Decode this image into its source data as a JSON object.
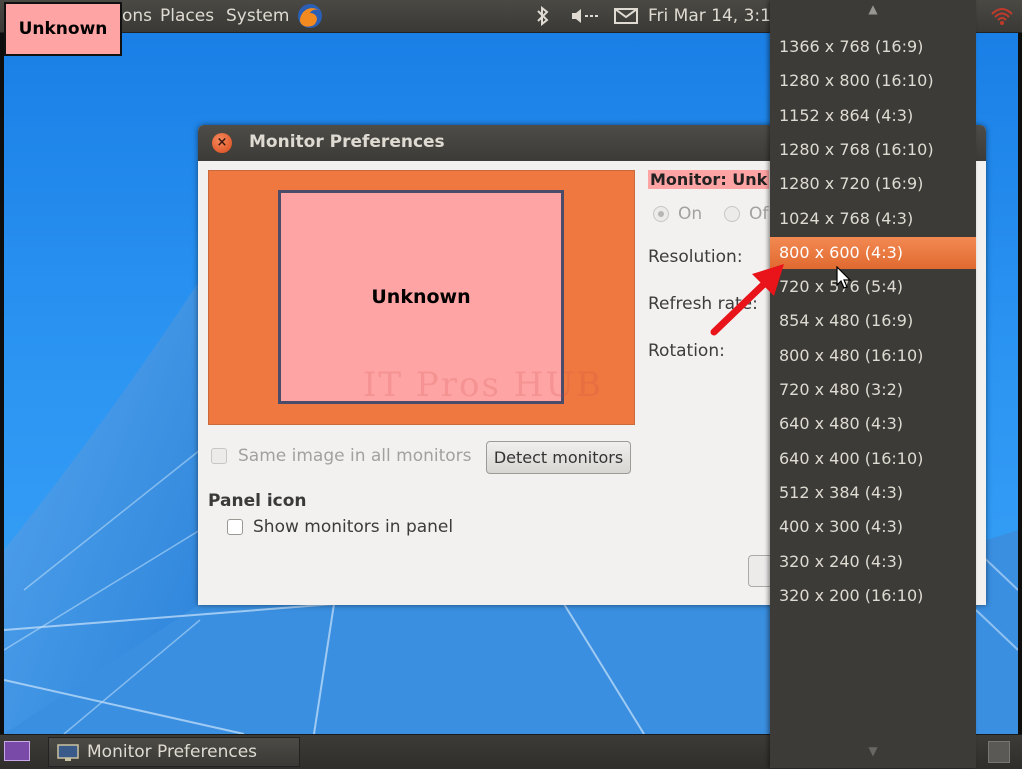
{
  "top_panel": {
    "menu_applications": "ons",
    "menu_places": "Places",
    "menu_system": "System",
    "datetime": "Fri Mar 14,  3:1",
    "volume_text": "◄---"
  },
  "monitor_label": "Unknown",
  "dialog": {
    "title": "Monitor Preferences",
    "close_glyph": "×",
    "monitor_name": "Unknown",
    "monitor_heading": "Monitor: Unk",
    "on_label": "On",
    "off_label": "Of",
    "resolution_label": "Resolution:",
    "refresh_label": "Refresh rate:",
    "rotation_label": "Rotation:",
    "same_image_label": "Same image in all monitors",
    "detect_button": "Detect monitors",
    "panel_icon_heading": "Panel icon",
    "show_monitors_label": "Show monitors in panel",
    "watermark": "IT Pros HUB"
  },
  "resolution_menu": {
    "selected_index": 6,
    "items": [
      "1366 x 768 (16:9)",
      "1280 x 800 (16:10)",
      "1152 x 864 (4:3)",
      "1280 x 768 (16:10)",
      "1280 x 720 (16:9)",
      "1024 x 768 (4:3)",
      "800 x 600 (4:3)",
      "720 x 576 (5:4)",
      "854 x 480 (16:9)",
      "800 x 480 (16:10)",
      "720 x 480 (3:2)",
      "640 x 480 (4:3)",
      "640 x 400 (16:10)",
      "512 x 384 (4:3)",
      "400 x 300 (4:3)",
      "320 x 240 (4:3)",
      "320 x 200 (16:10)"
    ]
  },
  "taskbar": {
    "window_title": "Monitor Preferences"
  },
  "colors": {
    "accent": "#e06a30",
    "monitor_bg": "#ee7840",
    "monitor_box": "#ffa4a4",
    "arrow": "#e8141a"
  },
  "icons": [
    "firefox-icon",
    "bluetooth-icon",
    "volume-icon",
    "mail-icon",
    "network-icon",
    "close-icon",
    "monitor-icon",
    "trash-icon"
  ]
}
